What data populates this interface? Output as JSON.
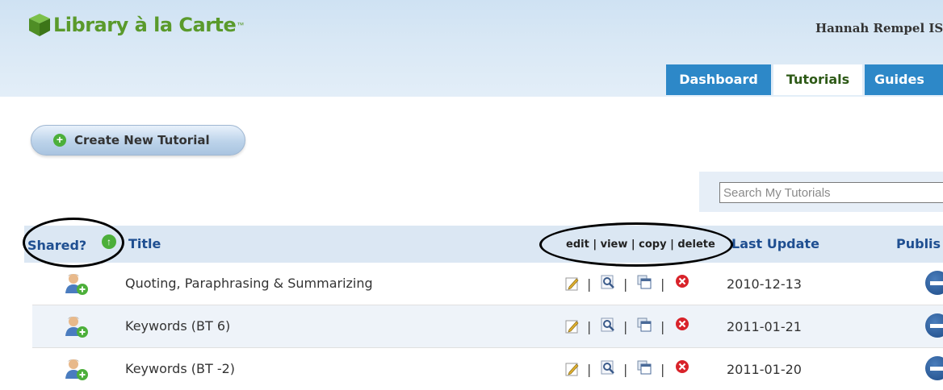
{
  "app": {
    "logo_text": "Library à la Carte",
    "logo_tm": "™",
    "user": "Hannah Rempel IS"
  },
  "tabs": [
    {
      "label": "Dashboard",
      "active": false
    },
    {
      "label": "Tutorials",
      "active": true
    },
    {
      "label": "Guides",
      "active": false
    }
  ],
  "toolbar": {
    "create_label": "Create New Tutorial"
  },
  "search": {
    "placeholder": "Search My Tutorials",
    "value": ""
  },
  "table": {
    "headers": {
      "shared": "Shared?",
      "title": "Title",
      "actions": "edit | view | copy | delete",
      "last_update": "Last Update",
      "publish": "Publis"
    },
    "separator": "|",
    "rows": [
      {
        "title": "Quoting, Paraphrasing & Summarizing",
        "date": "2010-12-13"
      },
      {
        "title": "Keywords (BT 6)",
        "date": "2011-01-21"
      },
      {
        "title": "Keywords (BT -2)",
        "date": "2011-01-20"
      }
    ]
  },
  "colors": {
    "brand_green": "#5a9a2b",
    "tab_blue": "#2d88c8",
    "header_link": "#1f4f91"
  },
  "icons": [
    "cube-logo-icon",
    "add-circle-icon",
    "sort-up-icon",
    "shared-user-add-icon",
    "edit-icon",
    "view-icon",
    "copy-icon",
    "delete-icon",
    "publish-toggle-icon"
  ]
}
